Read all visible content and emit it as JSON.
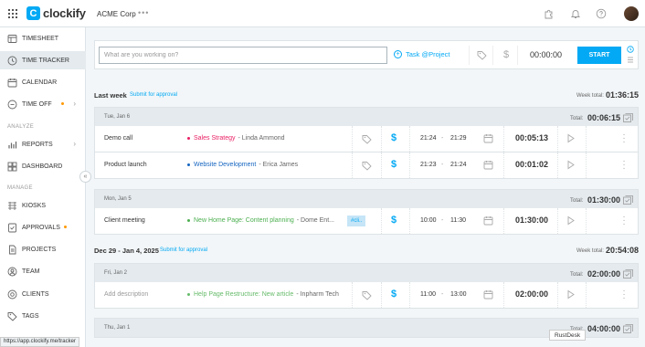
{
  "app": {
    "name": "clockify",
    "logo_letter": "C",
    "workspace": "ACME Corp",
    "workspace_more": "•••"
  },
  "status_bar": {
    "url": "https://app.clockify.me/tracker"
  },
  "overlay": {
    "label": "RustDesk"
  },
  "sidebar": {
    "items": [
      {
        "label": "TIMESHEET",
        "icon": "timesheet-icon"
      },
      {
        "label": "TIME TRACKER",
        "icon": "clock-icon",
        "active": true
      },
      {
        "label": "CALENDAR",
        "icon": "calendar-icon"
      },
      {
        "label": "TIME OFF",
        "icon": "time-off-icon"
      },
      {
        "label": "REPORTS",
        "icon": "reports-icon"
      },
      {
        "label": "DASHBOARD",
        "icon": "dashboard-icon"
      },
      {
        "label": "KIOSKS",
        "icon": "kiosk-icon"
      },
      {
        "label": "APPROVALS",
        "icon": "approvals-icon"
      },
      {
        "label": "PROJECTS",
        "icon": "projects-icon"
      },
      {
        "label": "TEAM",
        "icon": "team-icon"
      },
      {
        "label": "CLIENTS",
        "icon": "clients-icon"
      },
      {
        "label": "TAGS",
        "icon": "tags-icon"
      }
    ],
    "sections": {
      "analyze": "ANALYZE",
      "manage": "MANAGE"
    }
  },
  "timer": {
    "placeholder": "What are you working on?",
    "project_label": "Task @Project",
    "time": "00:00:00",
    "start_label": "START",
    "accent": "#03a9f4"
  },
  "weeks": [
    {
      "label": "Last week",
      "approval": "Submit for approval",
      "total_label": "Week total:",
      "total": "01:36:15"
    },
    {
      "label": "Dec 29 - Jan 4, 2025",
      "approval": "Submit for approval",
      "total_label": "Week total:",
      "total": "20:54:08"
    }
  ],
  "days": [
    {
      "label": "Tue, Jan 6",
      "total_label": "Total:",
      "total": "00:06:15"
    },
    {
      "label": "Mon, Jan 5",
      "total_label": "Total:",
      "total": "01:30:00"
    },
    {
      "label": "Fri, Jan 2",
      "total_label": "Total:",
      "total": "02:00:00"
    },
    {
      "label": "Thu, Jan 1",
      "total_label": "Total:",
      "total": "04:00:00"
    }
  ],
  "entries": [
    {
      "description": "Demo call",
      "project": "Sales Strategy",
      "project_color": "#e91e63",
      "client": "- Linda Ammond",
      "start": "21:24",
      "dash": "-",
      "end": "21:29",
      "duration": "00:05:13"
    },
    {
      "description": "Product launch",
      "project": "Website Development",
      "project_color": "#1565c0",
      "client": "- Erica James",
      "start": "21:23",
      "dash": "-",
      "end": "21:24",
      "duration": "00:01:02"
    },
    {
      "description": "Client meeting",
      "project": "New Home Page: Content planning",
      "project_color": "#4caf50",
      "client": "- Dome Ent...",
      "tag": "#cli..",
      "start": "10:00",
      "dash": "-",
      "end": "11:30",
      "duration": "01:30:00"
    },
    {
      "description": "Add description",
      "project": "Help Page Restructure: New article",
      "project_color": "#66bb6a",
      "client": "- Inpharm Tech",
      "start": "11:00",
      "dash": "-",
      "end": "13:00",
      "duration": "02:00:00"
    }
  ]
}
